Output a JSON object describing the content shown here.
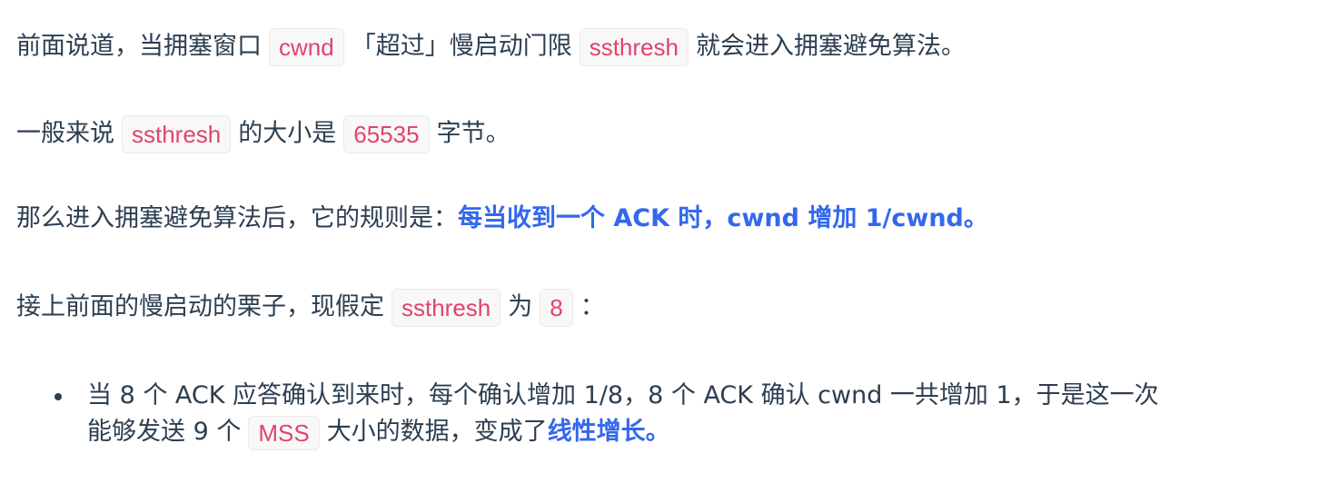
{
  "p1": {
    "t1": "前面说道，当拥塞窗口",
    "c1": "cwnd",
    "t2": "「超过」慢启动门限",
    "c2": "ssthresh",
    "t3": "就会进入拥塞避免算法。"
  },
  "p2": {
    "t1": "一般来说",
    "c1": "ssthresh",
    "t2": "的大小是",
    "c2": "65535",
    "t3": "字节。"
  },
  "p3": {
    "t1": "那么进入拥塞避免算法后，它的规则是：",
    "highlight": "每当收到一个 ACK 时，cwnd 增加 1/cwnd。"
  },
  "p4": {
    "t1": "接上前面的慢启动的栗子，现假定",
    "c1": "ssthresh",
    "t2": "为",
    "c2": "8",
    "t3": "："
  },
  "list": {
    "item1": {
      "line1": "当 8 个 ACK 应答确认到来时，每个确认增加 1/8，8 个 ACK 确认 cwnd 一共增加 1，于是这一次",
      "t1": "能够发送 9 个",
      "c1": "MSS",
      "t2": "大小的数据，变成了",
      "highlight": "线性增长。"
    }
  },
  "colors": {
    "text": "#2c3e50",
    "code": "#e2446b",
    "highlight": "#3367ee"
  }
}
